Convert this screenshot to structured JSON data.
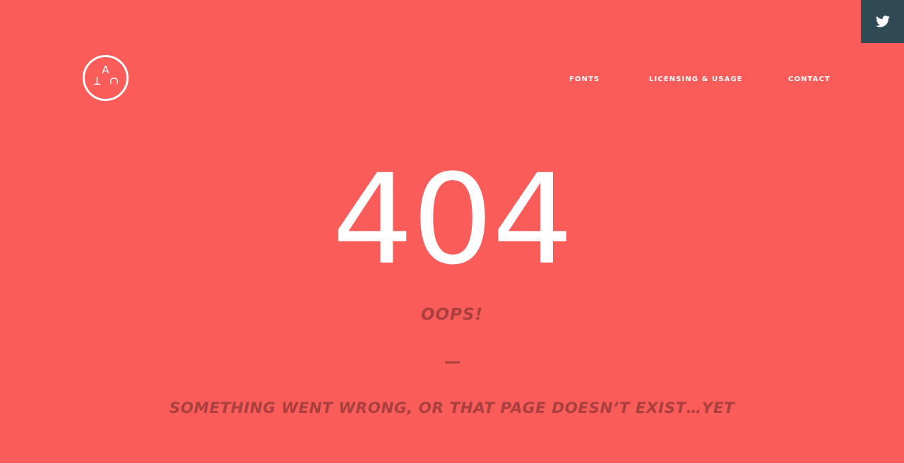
{
  "header": {
    "logo": {
      "letters": [
        "A",
        "T",
        "C"
      ],
      "icon": "atc-circle-logo"
    },
    "nav": [
      {
        "label": "FONTS"
      },
      {
        "label": "LICENSING & USAGE"
      },
      {
        "label": "CONTACT"
      }
    ],
    "social": {
      "icon": "twitter-icon"
    }
  },
  "main": {
    "code": "404",
    "title": "OOPS!",
    "message": "SOMETHING WENT WRONG, OR THAT PAGE DOESN’T EXIST…YET"
  },
  "colors": {
    "background": "#FA5C5A",
    "text_dark": "#A9403F",
    "text_light": "#FFFFFF",
    "twitter_tab": "#2F4A55"
  }
}
